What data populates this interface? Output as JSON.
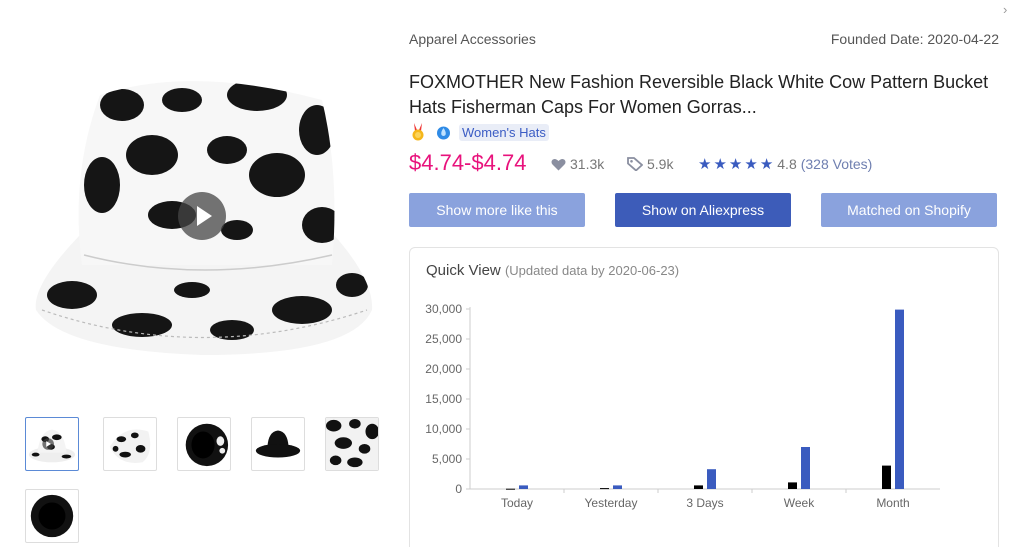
{
  "window": {
    "close_icon": "chevron-right-icon"
  },
  "product": {
    "category": "Apparel Accessories",
    "founded": "Founded Date: 2020-04-22",
    "title": "FOXMOTHER New Fashion Reversible Black White Cow Pattern Bucket Hats Fisherman Caps For Women Gorras...",
    "tag": "Women's Hats",
    "price": "$4.74-$4.74",
    "likes": "31.3k",
    "orders": "5.9k",
    "rating": "4.8",
    "votes": "(328 Votes)",
    "stars": 5
  },
  "gallery": {
    "thumbnails": [
      "cow-bucket-hat-front",
      "cow-bucket-hat-side",
      "cow-hat-reversible-black",
      "black-bucket-hat",
      "cow-pattern-closeup",
      "black-hat-top"
    ],
    "active_index": 0
  },
  "buttons": {
    "more_like": "Show more like this",
    "aliexpress": "Show on Aliexpress",
    "shopify": "Matched on Shopify"
  },
  "quick_view": {
    "title": "Quick View",
    "updated": "(Updated data by 2020-06-23)"
  },
  "colors": {
    "price": "#e8127c",
    "accent": "#3d5cb9",
    "accent_light": "#8aa2dd",
    "series_blue": "#3a5bbf",
    "series_black": "#000000"
  },
  "chart_data": {
    "type": "bar",
    "categories": [
      "Today",
      "Yesterday",
      "3 Days",
      "Week",
      "Month"
    ],
    "series": [
      {
        "values": [
          50,
          150,
          600,
          1100,
          3900
        ]
      },
      {
        "values": [
          600,
          600,
          3300,
          7000,
          29900
        ]
      }
    ],
    "yticks": [
      "0",
      "5,000",
      "10,000",
      "15,000",
      "20,000",
      "25,000",
      "30,000"
    ],
    "ylim": [
      0,
      30000
    ],
    "grid": false
  }
}
